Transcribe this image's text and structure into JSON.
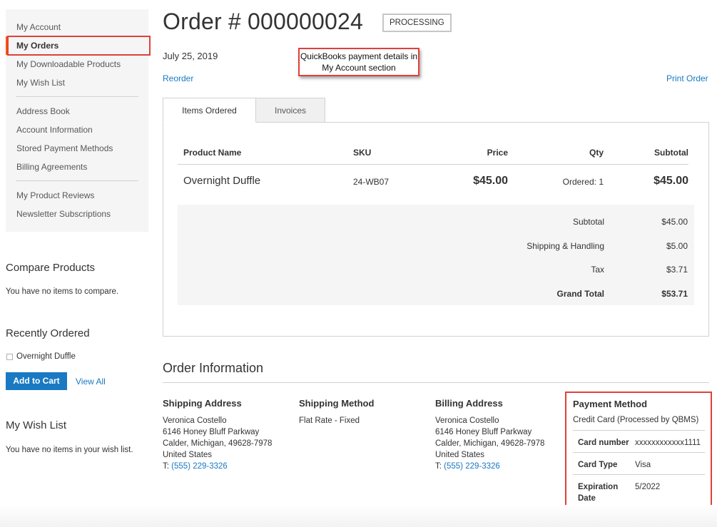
{
  "sidebar": {
    "nav_groups": [
      [
        "My Account",
        "My Orders",
        "My Downloadable Products",
        "My Wish List"
      ],
      [
        "Address Book",
        "Account Information",
        "Stored Payment Methods",
        "Billing Agreements"
      ],
      [
        "My Product Reviews",
        "Newsletter Subscriptions"
      ]
    ],
    "current": "My Orders",
    "compare": {
      "title": "Compare Products",
      "empty_text": "You have no items to compare."
    },
    "recent": {
      "title": "Recently Ordered",
      "item": "Overnight Duffle",
      "add_to_cart": "Add to Cart",
      "view_all": "View All"
    },
    "wishlist": {
      "title": "My Wish List",
      "empty_text": "You have no items in your wish list."
    }
  },
  "order": {
    "title": "Order # 000000024",
    "status": "PROCESSING",
    "date": "July 25, 2019",
    "reorder": "Reorder",
    "print": "Print Order",
    "callout": "QuickBooks payment details in My Account section"
  },
  "tabs": [
    "Items Ordered",
    "Invoices"
  ],
  "items_table": {
    "headers": {
      "name": "Product Name",
      "sku": "SKU",
      "price": "Price",
      "qty": "Qty",
      "subtotal": "Subtotal"
    },
    "rows": [
      {
        "name": "Overnight Duffle",
        "sku": "24-WB07",
        "price": "$45.00",
        "qty": "Ordered: 1",
        "subtotal": "$45.00"
      }
    ]
  },
  "totals": [
    {
      "label": "Subtotal",
      "value": "$45.00"
    },
    {
      "label": "Shipping & Handling",
      "value": "$5.00"
    },
    {
      "label": "Tax",
      "value": "$3.71"
    },
    {
      "label": "Grand Total",
      "value": "$53.71"
    }
  ],
  "order_info": {
    "title": "Order Information",
    "shipping_address": {
      "title": "Shipping Address",
      "lines": [
        "Veronica Costello",
        "6146 Honey Bluff Parkway",
        "Calder, Michigan, 49628-7978",
        "United States"
      ],
      "phone_prefix": "T:",
      "phone": "(555) 229-3326"
    },
    "shipping_method": {
      "title": "Shipping Method",
      "value": "Flat Rate - Fixed"
    },
    "billing_address": {
      "title": "Billing Address",
      "lines": [
        "Veronica Costello",
        "6146 Honey Bluff Parkway",
        "Calder, Michigan, 49628-7978",
        "United States"
      ],
      "phone_prefix": "T:",
      "phone": "(555) 229-3326"
    },
    "payment": {
      "title": "Payment Method",
      "method": "Credit Card (Processed by QBMS)",
      "card_number_label": "Card number",
      "card_number": "xxxxxxxxxxxx1111",
      "card_type_label": "Card Type",
      "card_type": "Visa",
      "expiration_label": "Expiration Date",
      "expiration": "5/2022"
    }
  },
  "colors": {
    "link": "#1979c3",
    "highlight": "#e0403a",
    "button": "#1979c3"
  }
}
